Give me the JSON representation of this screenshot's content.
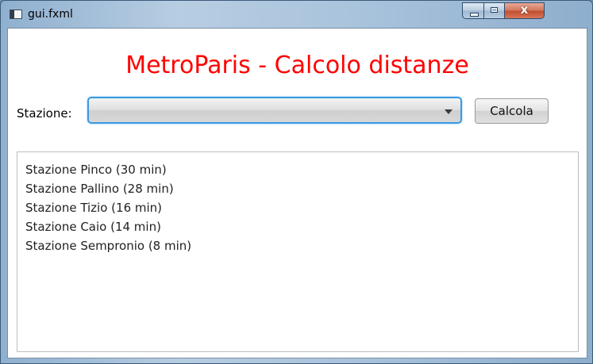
{
  "window": {
    "title": "gui.fxml",
    "close_glyph": "x"
  },
  "heading": "MetroParis - Calcolo distanze",
  "form": {
    "station_label": "Stazione:",
    "station_combo_value": "",
    "calc_button": "Calcola"
  },
  "results": [
    "Stazione Pinco (30 min)",
    "Stazione Pallino (28 min)",
    "Stazione Tizio (16 min)",
    "Stazione Caio (14 min)",
    "Stazione Sempronio (8 min)"
  ],
  "colors": {
    "heading": "#ff0000",
    "focus_border": "#3a9ae0"
  },
  "icons": {
    "app": "java-app-icon",
    "minimize": "minimize-icon",
    "maximize": "maximize-icon",
    "close": "close-icon",
    "dropdown": "chevron-down-icon"
  }
}
